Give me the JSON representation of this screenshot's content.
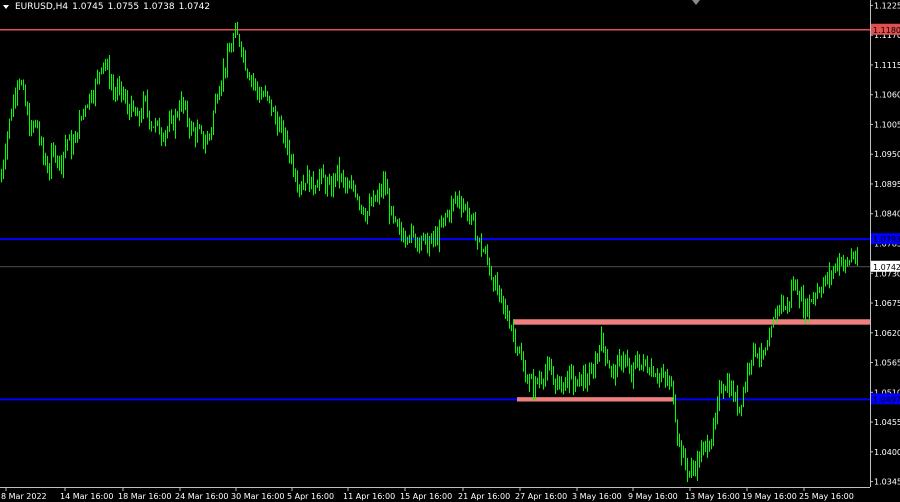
{
  "window": {
    "symbol_timeframe": "EURUSD,H4",
    "ohlc": [
      "1.0745",
      "1.0755",
      "1.0738",
      "1.0742"
    ]
  },
  "colors": {
    "background": "#000000",
    "candle": "#00ff00",
    "axis_text": "#ffffff",
    "frame": "#c0c0c0",
    "red_line": "#e05050",
    "blue_line": "#0000ff",
    "zone": "#f08080",
    "current_price_line": "#808080"
  },
  "chart_data": {
    "type": "candlestick",
    "symbol": "EURUSD",
    "timeframe": "H4",
    "ylim": [
      1.0335,
      1.1235
    ],
    "y_ticks": [
      "1.1225",
      "1.1170",
      "1.1115",
      "1.1060",
      "1.1005",
      "1.0950",
      "1.0895",
      "1.0840",
      "1.0785",
      "1.0730",
      "1.0675",
      "1.0620",
      "1.0565",
      "1.0510",
      "1.0455",
      "1.0400",
      "1.0345"
    ],
    "x_ticks": [
      "8 Mar 2022",
      "14 Mar 16:00",
      "18 Mar 16:00",
      "24 Mar 16:00",
      "30 Mar 16:00",
      "5 Apr 16:00",
      "11 Apr 16:00",
      "15 Apr 16:00",
      "21 Apr 16:00",
      "27 Apr 16:00",
      "3 May 16:00",
      "9 May 16:00",
      "13 May 16:00",
      "19 May 16:00",
      "25 May 16:00"
    ],
    "close_path": [
      [
        0,
        1.09
      ],
      [
        6,
        1.098
      ],
      [
        12,
        1.104
      ],
      [
        18,
        1.11
      ],
      [
        24,
        1.105
      ],
      [
        30,
        1.099
      ],
      [
        36,
        1.101
      ],
      [
        42,
        1.095
      ],
      [
        48,
        1.092
      ],
      [
        54,
        1.096
      ],
      [
        60,
        1.093
      ],
      [
        66,
        1.098
      ],
      [
        72,
        1.096
      ],
      [
        78,
        1.1
      ],
      [
        84,
        1.104
      ],
      [
        90,
        1.106
      ],
      [
        96,
        1.108
      ],
      [
        102,
        1.113
      ],
      [
        108,
        1.11
      ],
      [
        114,
        1.106
      ],
      [
        120,
        1.107
      ],
      [
        126,
        1.104
      ],
      [
        132,
        1.103
      ],
      [
        138,
        1.101
      ],
      [
        144,
        1.105
      ],
      [
        150,
        1.101
      ],
      [
        156,
        1.1
      ],
      [
        162,
        1.099
      ],
      [
        168,
        1.1
      ],
      [
        174,
        1.101
      ],
      [
        180,
        1.105
      ],
      [
        186,
        1.102
      ],
      [
        192,
        1.099
      ],
      [
        198,
        1.099
      ],
      [
        204,
        1.097
      ],
      [
        210,
        1.099
      ],
      [
        216,
        1.106
      ],
      [
        222,
        1.11
      ],
      [
        228,
        1.113
      ],
      [
        234,
        1.117
      ],
      [
        240,
        1.116
      ],
      [
        246,
        1.111
      ],
      [
        252,
        1.109
      ],
      [
        258,
        1.106
      ],
      [
        264,
        1.106
      ],
      [
        270,
        1.104
      ],
      [
        276,
        1.101
      ],
      [
        282,
        1.099
      ],
      [
        288,
        1.096
      ],
      [
        294,
        1.092
      ],
      [
        300,
        1.089
      ],
      [
        306,
        1.091
      ],
      [
        312,
        1.089
      ],
      [
        318,
        1.091
      ],
      [
        324,
        1.09
      ],
      [
        330,
        1.088
      ],
      [
        336,
        1.092
      ],
      [
        342,
        1.09
      ],
      [
        348,
        1.088
      ],
      [
        354,
        1.089
      ],
      [
        360,
        1.086
      ],
      [
        366,
        1.084
      ],
      [
        372,
        1.086
      ],
      [
        378,
        1.087
      ],
      [
        384,
        1.09
      ],
      [
        390,
        1.084
      ],
      [
        396,
        1.081
      ],
      [
        402,
        1.08
      ],
      [
        408,
        1.081
      ],
      [
        414,
        1.079
      ],
      [
        420,
        1.08
      ],
      [
        426,
        1.078
      ],
      [
        432,
        1.079
      ],
      [
        438,
        1.08
      ],
      [
        444,
        1.083
      ],
      [
        450,
        1.085
      ],
      [
        456,
        1.087
      ],
      [
        462,
        1.086
      ],
      [
        468,
        1.084
      ],
      [
        474,
        1.081
      ],
      [
        480,
        1.078
      ],
      [
        486,
        1.076
      ],
      [
        492,
        1.072
      ],
      [
        498,
        1.069
      ],
      [
        504,
        1.066
      ],
      [
        510,
        1.064
      ],
      [
        516,
        1.06
      ],
      [
        522,
        1.056
      ],
      [
        528,
        1.053
      ],
      [
        534,
        1.052
      ],
      [
        540,
        1.054
      ],
      [
        546,
        1.055
      ],
      [
        552,
        1.054
      ],
      [
        558,
        1.052
      ],
      [
        564,
        1.053
      ],
      [
        570,
        1.054
      ],
      [
        576,
        1.052
      ],
      [
        582,
        1.054
      ],
      [
        588,
        1.053
      ],
      [
        594,
        1.056
      ],
      [
        600,
        1.061
      ],
      [
        606,
        1.058
      ],
      [
        612,
        1.054
      ],
      [
        618,
        1.056
      ],
      [
        624,
        1.058
      ],
      [
        630,
        1.053
      ],
      [
        636,
        1.057
      ],
      [
        642,
        1.056
      ],
      [
        648,
        1.056
      ],
      [
        654,
        1.055
      ],
      [
        660,
        1.054
      ],
      [
        666,
        1.053
      ],
      [
        672,
        1.052
      ],
      [
        678,
        1.042
      ],
      [
        684,
        1.038
      ],
      [
        690,
        1.036
      ],
      [
        696,
        1.038
      ],
      [
        702,
        1.04
      ],
      [
        708,
        1.042
      ],
      [
        714,
        1.044
      ],
      [
        720,
        1.052
      ],
      [
        726,
        1.053
      ],
      [
        732,
        1.051
      ],
      [
        738,
        1.048
      ],
      [
        744,
        1.052
      ],
      [
        750,
        1.058
      ],
      [
        756,
        1.059
      ],
      [
        762,
        1.057
      ],
      [
        768,
        1.059
      ],
      [
        774,
        1.065
      ],
      [
        780,
        1.068
      ],
      [
        786,
        1.066
      ],
      [
        792,
        1.071
      ],
      [
        798,
        1.07
      ],
      [
        804,
        1.066
      ],
      [
        810,
        1.068
      ],
      [
        816,
        1.07
      ],
      [
        822,
        1.071
      ],
      [
        828,
        1.072
      ],
      [
        834,
        1.074
      ],
      [
        840,
        1.076
      ],
      [
        846,
        1.074
      ],
      [
        852,
        1.077
      ],
      [
        858,
        1.0742
      ]
    ],
    "levels": {
      "red_resistance": 1.118,
      "blue_upper": 1.0793,
      "blue_lower": 1.0497,
      "current_price": 1.0742
    },
    "zones": [
      {
        "from": 1.0635,
        "to": 1.0645
      },
      {
        "from": 1.0493,
        "to": 1.0501
      }
    ],
    "price_labels": {
      "red": "1.1180",
      "blue_upper": "1.0793",
      "current": "1.0742",
      "blue_lower": "1.0497"
    }
  }
}
